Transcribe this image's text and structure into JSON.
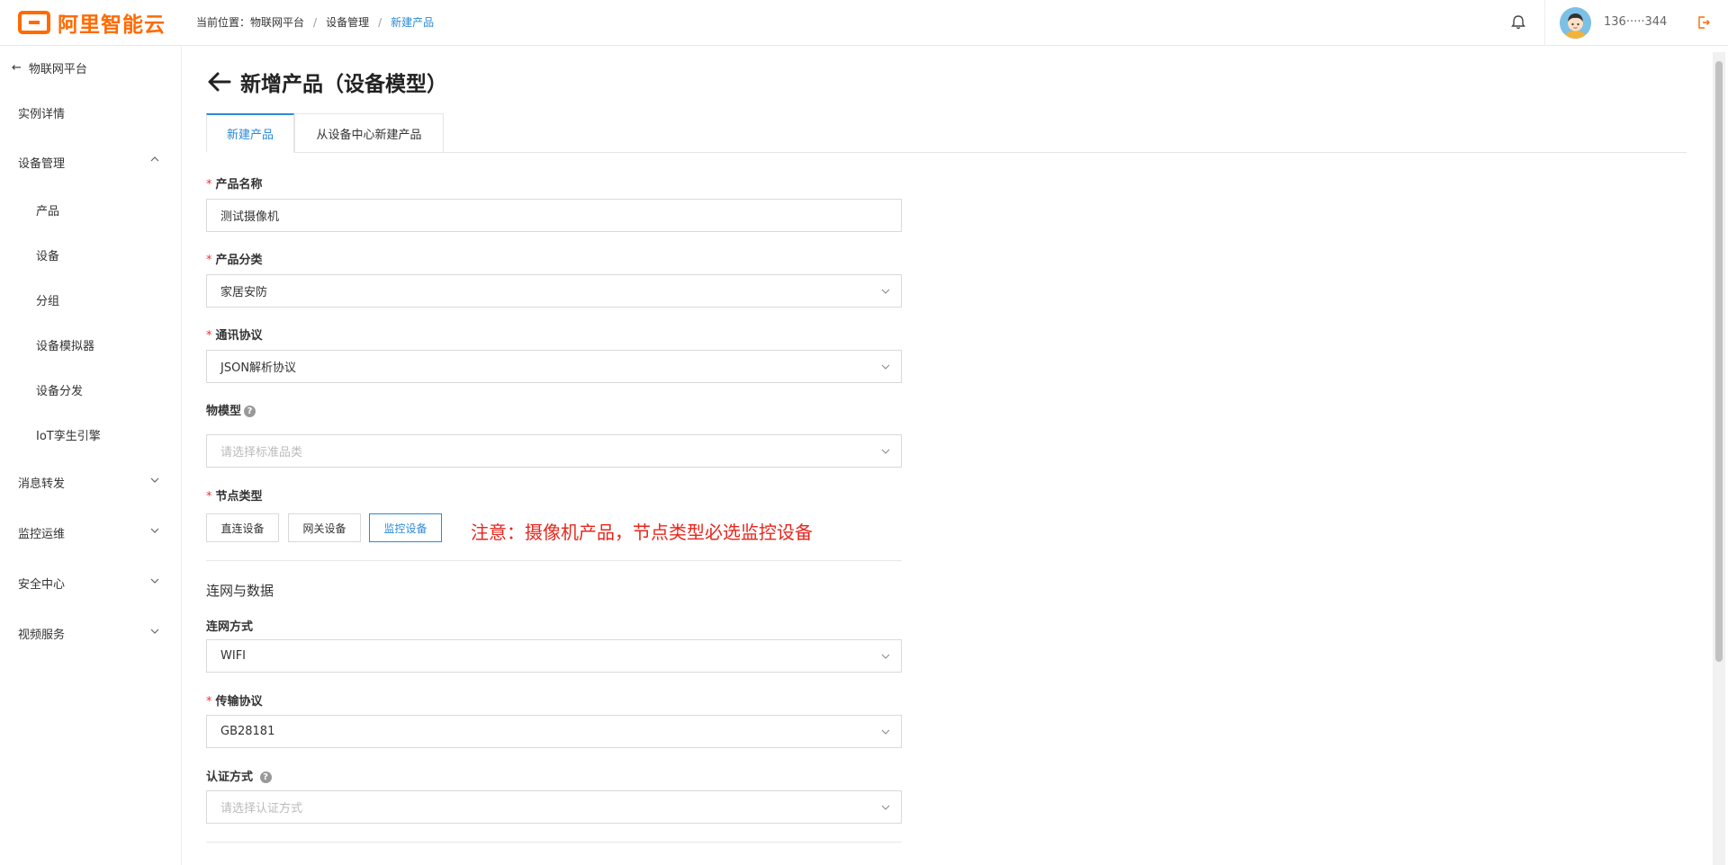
{
  "header": {
    "logo_text": "阿里智能云",
    "breadcrumb": {
      "prefix": "当前位置：",
      "items": [
        "物联网平台",
        "设备管理",
        "新建产品"
      ]
    },
    "username": "136·····344",
    "icons": [
      "bell-icon",
      "logout-icon"
    ]
  },
  "sidebar": {
    "back_label": "物联网平台",
    "items": [
      {
        "label": "实例详情"
      },
      {
        "label": "设备管理",
        "expanded": true,
        "children": [
          "产品",
          "设备",
          "分组",
          "设备模拟器",
          "设备分发",
          "IoT孪生引擎"
        ]
      },
      {
        "label": "消息转发"
      },
      {
        "label": "监控运维"
      },
      {
        "label": "安全中心"
      },
      {
        "label": "视频服务"
      }
    ]
  },
  "page": {
    "title": "新增产品（设备模型）",
    "tabs": [
      "新建产品",
      "从设备中心新建产品"
    ],
    "active_tab": 0
  },
  "form": {
    "product_name": {
      "label": "产品名称",
      "required": true,
      "value": "测试摄像机"
    },
    "category": {
      "label": "产品分类",
      "required": true,
      "value": "家居安防"
    },
    "protocol": {
      "label": "通讯协议",
      "required": true,
      "value": "JSON解析协议"
    },
    "thing_model": {
      "label": "物模型",
      "required": false,
      "placeholder": "请选择标准品类"
    },
    "node_type": {
      "label": "节点类型",
      "required": true,
      "options": [
        "直连设备",
        "网关设备",
        "监控设备"
      ],
      "selected": "监控设备",
      "note": "注意：摄像机产品，节点类型必选监控设备"
    },
    "network_section": "连网与数据",
    "network_method": {
      "label": "连网方式",
      "required": false,
      "value": "WIFI"
    },
    "transport": {
      "label": "传输协议",
      "required": true,
      "value": "GB28181"
    },
    "auth": {
      "label": "认证方式",
      "required": false,
      "placeholder": "请选择认证方式"
    }
  },
  "colors": {
    "brand": "#ff6a00",
    "accent": "#2b8ad8",
    "required": "#e33333",
    "note": "#e8261d"
  }
}
